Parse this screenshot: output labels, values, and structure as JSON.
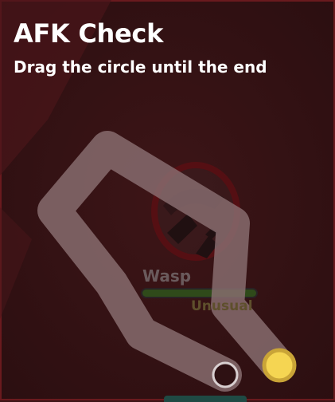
{
  "dialog": {
    "title": "AFK Check",
    "subtitle": "Drag the circle until the end"
  },
  "background_mob": {
    "name": "Wasp",
    "rarity": "Unusual",
    "health_fraction": 1.0
  },
  "afk_path": {
    "start_handle_color": "#f5d552",
    "end_marker": "ring",
    "handle_position": "start"
  },
  "colors": {
    "overlay": "#3a1416",
    "path": "#8a6f72",
    "handle_fill": "#f5d552",
    "handle_border": "#c9a437",
    "health_bar": "#2f4a1a",
    "rarity_text": "#5e4f2c"
  },
  "icons": {
    "mob_icon": "wasp-icon",
    "start_handle": "drag-handle-circle",
    "end_marker": "end-ring"
  }
}
